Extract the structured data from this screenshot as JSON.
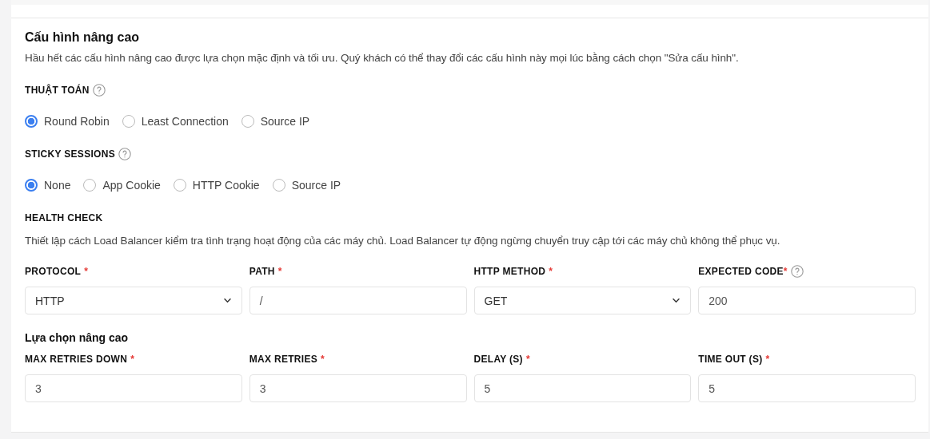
{
  "title": "Cấu hình nâng cao",
  "description": "Hầu hết các cấu hình nâng cao được lựa chọn mặc định và tối ưu. Quý khách có thể thay đổi các cấu hình này mọi lúc bằng cách chọn \"Sửa cấu hình\".",
  "radio_groups": [
    {
      "label": "THUẬT TOÁN",
      "help": true,
      "options": [
        {
          "label": "Round Robin",
          "selected": true
        },
        {
          "label": "Least Connection",
          "selected": false
        },
        {
          "label": "Source IP",
          "selected": false
        }
      ]
    },
    {
      "label": "STICKY SESSIONS",
      "help": true,
      "options": [
        {
          "label": "None",
          "selected": true
        },
        {
          "label": "App Cookie",
          "selected": false
        },
        {
          "label": "HTTP Cookie",
          "selected": false
        },
        {
          "label": "Source IP",
          "selected": false
        }
      ]
    }
  ],
  "health_check": {
    "label": "HEALTH CHECK",
    "description": "Thiết lập cách Load Balancer kiểm tra tình trạng hoạt động của các máy chủ. Load Balancer tự động ngừng chuyển truy cập tới các máy chủ không thể phục vụ.",
    "fields": [
      {
        "kind": "select",
        "label": "PROTOCOL",
        "required_mark": "*",
        "help": false,
        "value": "HTTP"
      },
      {
        "kind": "input",
        "label": "PATH",
        "required_mark": "*",
        "help": false,
        "value": "/"
      },
      {
        "kind": "select",
        "label": "HTTP METHOD",
        "required_mark": "*",
        "help": false,
        "value": "GET"
      },
      {
        "kind": "input",
        "label": "EXPECTED CODE",
        "required_mark": "*",
        "help": true,
        "value": "200"
      }
    ]
  },
  "advanced": {
    "title": "Lựa chọn nâng cao",
    "fields": [
      {
        "kind": "input",
        "label": "MAX RETRIES DOWN",
        "required_mark": "*",
        "help": false,
        "value": "3"
      },
      {
        "kind": "input",
        "label": "MAX RETRIES",
        "required_mark": "*",
        "help": false,
        "value": "3"
      },
      {
        "kind": "input",
        "label": "DELAY (S)",
        "required_mark": "*",
        "help": false,
        "value": "5"
      },
      {
        "kind": "input",
        "label": "TIME OUT (S)",
        "required_mark": "*",
        "help": false,
        "value": "5"
      }
    ]
  }
}
